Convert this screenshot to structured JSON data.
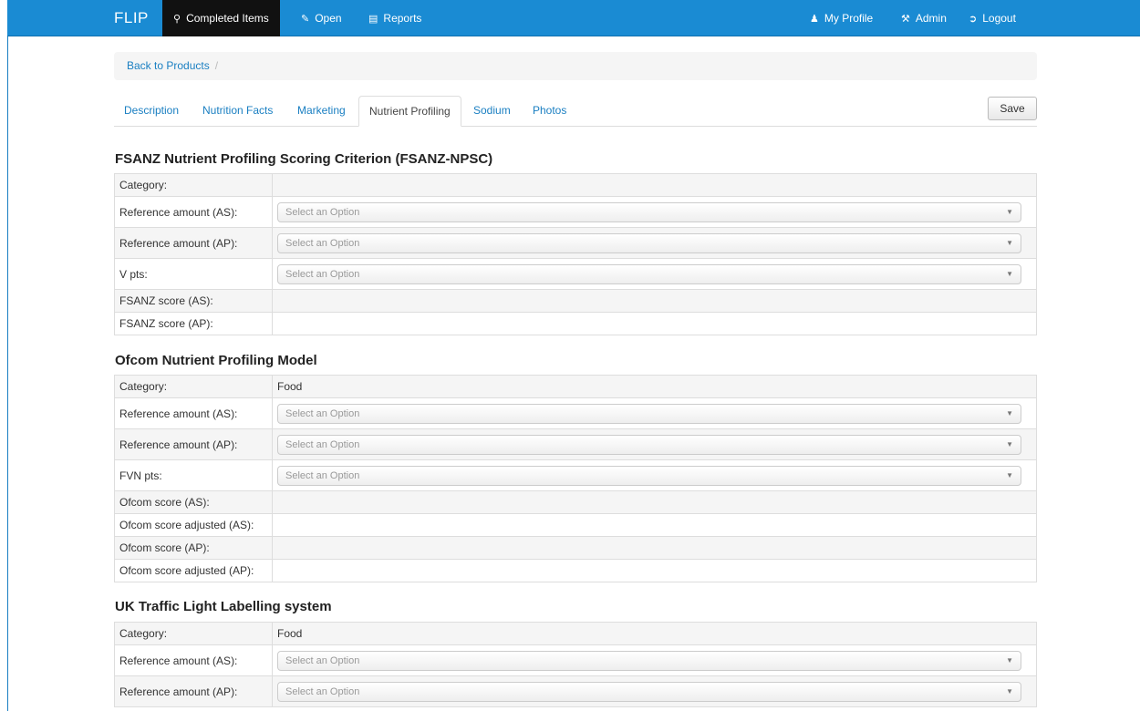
{
  "navbar": {
    "brand": "FLIP",
    "items": [
      {
        "label": "Completed Items",
        "icon": "search-icon"
      },
      {
        "label": "Open",
        "icon": "edit-icon"
      },
      {
        "label": "Reports",
        "icon": "report-icon"
      }
    ],
    "right_items": [
      {
        "label": "My Profile",
        "icon": "user-icon"
      },
      {
        "label": "Admin",
        "icon": "wrench-icon"
      },
      {
        "label": "Logout",
        "icon": "logout-icon"
      }
    ],
    "colors": {
      "bar": "#1a8bd3",
      "active": "#111111"
    }
  },
  "breadcrumb": {
    "back_label": "Back to Products",
    "separator": "/"
  },
  "tabs": [
    "Description",
    "Nutrition Facts",
    "Marketing",
    "Nutrient Profiling",
    "Sodium",
    "Photos"
  ],
  "active_tab": "Nutrient Profiling",
  "save_label": "Save",
  "select_placeholder": "Select an Option",
  "sections": [
    {
      "title": "FSANZ Nutrient Profiling Scoring Criterion (FSANZ-NPSC)",
      "rows": [
        {
          "label": "Category:",
          "value": ""
        },
        {
          "label": "Reference amount (AS):",
          "select": "Select an Option"
        },
        {
          "label": "Reference amount (AP):",
          "select": "Select an Option"
        },
        {
          "label": "V pts:",
          "select": "Select an Option"
        },
        {
          "label": "FSANZ score (AS):",
          "value": ""
        },
        {
          "label": "FSANZ score (AP):",
          "value": ""
        }
      ]
    },
    {
      "title": "Ofcom Nutrient Profiling Model",
      "rows": [
        {
          "label": "Category:",
          "value": "Food"
        },
        {
          "label": "Reference amount (AS):",
          "select": "Select an Option"
        },
        {
          "label": "Reference amount (AP):",
          "select": "Select an Option"
        },
        {
          "label": "FVN pts:",
          "select": "Select an Option"
        },
        {
          "label": "Ofcom score (AS):",
          "value": ""
        },
        {
          "label": "Ofcom score adjusted (AS):",
          "value": ""
        },
        {
          "label": "Ofcom score (AP):",
          "value": ""
        },
        {
          "label": "Ofcom score adjusted (AP):",
          "value": ""
        }
      ]
    },
    {
      "title": "UK Traffic Light Labelling system",
      "rows": [
        {
          "label": "Category:",
          "value": "Food"
        },
        {
          "label": "Reference amount (AS):",
          "select": "Select an Option"
        },
        {
          "label": "Reference amount (AP):",
          "select": "Select an Option"
        }
      ]
    }
  ]
}
